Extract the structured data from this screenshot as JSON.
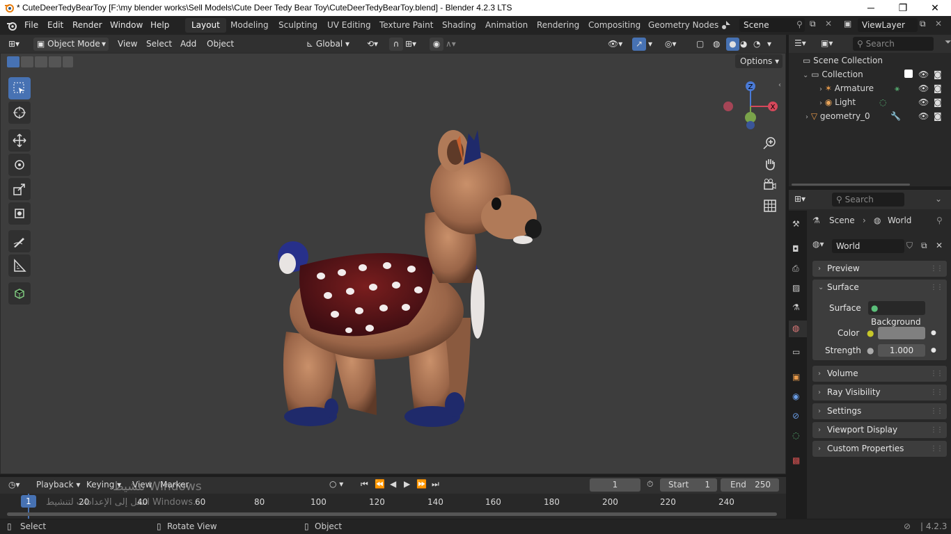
{
  "window": {
    "title": "* CuteDeerTedyBearToy [F:\\my blender works\\Sell Models\\Cute Deer Tedy Bear Toy\\CuteDeerTedyBearToy.blend] - Blender 4.2.3 LTS",
    "minimize": "─",
    "maximize": "❐",
    "close": "✕"
  },
  "menu": [
    "File",
    "Edit",
    "Render",
    "Window",
    "Help"
  ],
  "workspaces": [
    "Layout",
    "Modeling",
    "Sculpting",
    "UV Editing",
    "Texture Paint",
    "Shading",
    "Animation",
    "Rendering",
    "Compositing",
    "Geometry Nodes"
  ],
  "active_workspace": "Layout",
  "scene": {
    "name": "Scene",
    "view_layer": "ViewLayer"
  },
  "viewport_header": {
    "mode": "Object Mode",
    "menus": [
      "View",
      "Select",
      "Add",
      "Object"
    ],
    "orientation": "Global",
    "options": "Options"
  },
  "gizmo": {
    "x": "X",
    "y": "Y",
    "z": "Z"
  },
  "outliner": {
    "search_placeholder": "Search",
    "items": [
      {
        "label": "Scene Collection",
        "icon": "scene-collection-icon"
      },
      {
        "label": "Collection",
        "icon": "collection-icon"
      },
      {
        "label": "Armature",
        "icon": "armature-icon"
      },
      {
        "label": "Light",
        "icon": "light-icon"
      },
      {
        "label": "geometry_0",
        "icon": "mesh-icon"
      }
    ]
  },
  "properties": {
    "search_placeholder": "Search",
    "breadcrumb": [
      "Scene",
      "World"
    ],
    "world_name": "World",
    "panels": {
      "preview": "Preview",
      "surface": "Surface",
      "volume": "Volume",
      "ray_visibility": "Ray Visibility",
      "settings": "Settings",
      "viewport_display": "Viewport Display",
      "custom_properties": "Custom Properties"
    },
    "surface_label": "Surface",
    "surface_value": "Background",
    "color_label": "Color",
    "color_value": "#808080",
    "strength_label": "Strength",
    "strength_value": "1.000"
  },
  "timeline": {
    "menus": [
      "Playback",
      "Keying",
      "View",
      "Marker"
    ],
    "current_frame": "1",
    "start_label": "Start",
    "start": "1",
    "end_label": "End",
    "end": "250",
    "ticks": [
      "20",
      "40",
      "60",
      "80",
      "100",
      "120",
      "140",
      "160",
      "180",
      "200",
      "220",
      "240"
    ],
    "playhead": "1"
  },
  "statusbar": {
    "items": [
      "Select",
      "Rotate View",
      "Object"
    ],
    "version": "4.2.3"
  },
  "watermark": {
    "line1": "تنشيط Windows",
    "line2": "انتقل إلى الإعدادات لتنشيط Windows."
  }
}
